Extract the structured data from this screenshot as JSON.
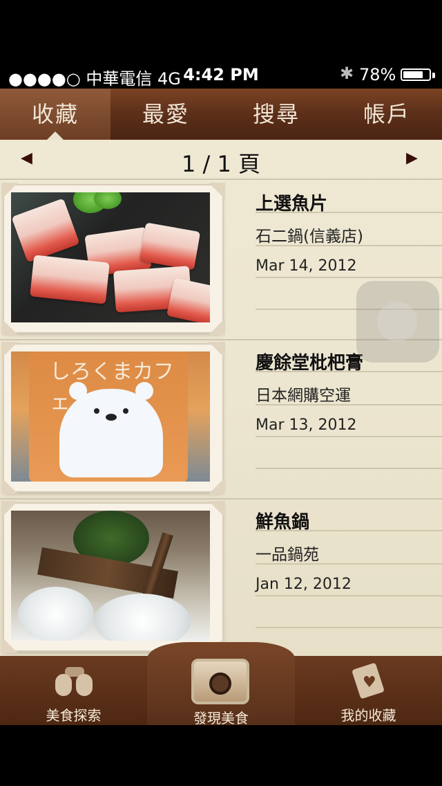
{
  "status": {
    "carrier": "●●●●○ 中華電信  4G",
    "time": "4:42 PM",
    "bluetooth_icon": "bluetooth-icon",
    "battery_pct": "78%",
    "battery_level": 0.78
  },
  "tabs": [
    {
      "label": "收藏",
      "active": true
    },
    {
      "label": "最愛",
      "active": false
    },
    {
      "label": "搜尋",
      "active": false
    },
    {
      "label": "帳戶",
      "active": false
    }
  ],
  "pager": {
    "prev_icon": "left-triangle-icon",
    "label": "1 / 1 頁",
    "next_icon": "right-triangle-icon"
  },
  "items": [
    {
      "title": "上選魚片",
      "place": "石二鍋(信義店)",
      "date": "Mar 14, 2012"
    },
    {
      "title": "慶餘堂枇杷膏",
      "place": "日本網購空運",
      "date": "Mar 13, 2012"
    },
    {
      "title": "鮮魚鍋",
      "place": "一品鍋苑",
      "date": "Jan 12, 2012"
    }
  ],
  "photo2_text": "しろくまカフェ",
  "bottom_nav": [
    {
      "label": "美食探索",
      "icon": "binoculars-icon"
    },
    {
      "label": "發現美食",
      "icon": "camera-icon"
    },
    {
      "label": "我的收藏",
      "icon": "heart-card-icon"
    }
  ]
}
